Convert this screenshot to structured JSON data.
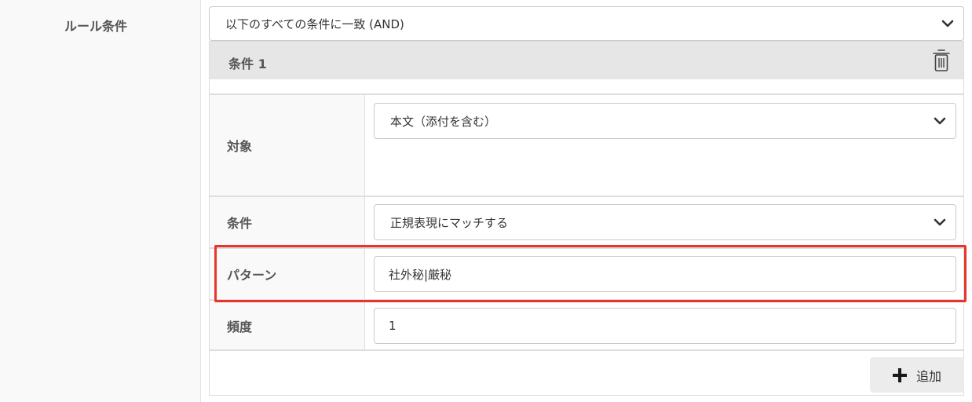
{
  "rule_condition": {
    "label": "ルール条件",
    "match_select": "以下のすべての条件に一致 (AND)"
  },
  "condition": {
    "title": "条件 1",
    "rows": {
      "target": {
        "label": "対象",
        "value": "本文（添付を含む）"
      },
      "operator": {
        "label": "条件",
        "value": "正規表現にマッチする"
      },
      "pattern": {
        "label": "パターン",
        "value": "社外秘|厳秘"
      },
      "frequency": {
        "label": "頻度",
        "value": "1"
      }
    }
  },
  "add_button": {
    "label": "追加"
  },
  "icons": [
    "chevron-down-icon",
    "trash-icon",
    "plus-icon"
  ],
  "colors": {
    "highlight": "#e8352a"
  }
}
